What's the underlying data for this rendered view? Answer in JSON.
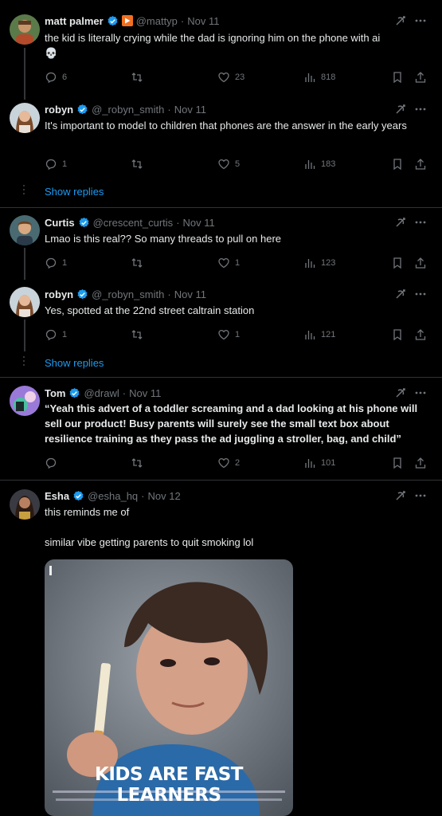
{
  "tweets": [
    {
      "name": "matt palmer",
      "handle": "@mattyp",
      "time": "Nov 11",
      "text": "the kid is literally crying while the dad is ignoring him on the phone with ai",
      "emoji": "💀",
      "replies": "6",
      "retweets": "",
      "likes": "23",
      "views": "818"
    },
    {
      "name": "robyn",
      "handle": "@_robyn_smith",
      "time": "Nov 11",
      "text": "It's important to model to children that phones are the answer in the early years",
      "replies": "1",
      "retweets": "",
      "likes": "5",
      "views": "183"
    },
    {
      "name": "Curtis",
      "handle": "@crescent_curtis",
      "time": "Nov 11",
      "text": "Lmao is this real?? So many threads to pull on here",
      "replies": "1",
      "retweets": "",
      "likes": "1",
      "views": "123"
    },
    {
      "name": "robyn",
      "handle": "@_robyn_smith",
      "time": "Nov 11",
      "text": "Yes, spotted at the 22nd street caltrain station",
      "replies": "1",
      "retweets": "",
      "likes": "1",
      "views": "121"
    },
    {
      "name": "Tom",
      "handle": "@drawl",
      "time": "Nov 11",
      "text": "“Yeah this advert of a toddler screaming and a dad looking at his phone will sell our product! Busy parents will surely see the small text box about resilience training as they pass the ad juggling a stroller, bag, and child”",
      "replies": "",
      "retweets": "",
      "likes": "2",
      "views": "101"
    },
    {
      "name": "Esha",
      "handle": "@esha_hq",
      "time": "Nov 12",
      "text": "this reminds me of",
      "text2": "similar vibe getting parents to quit smoking lol",
      "media_title": "KIDS ARE FAST LEARNERS"
    }
  ],
  "show_replies_label": "Show replies",
  "separator": "·",
  "colors": {
    "background": "#000000",
    "text": "#e7e9ea",
    "muted": "#71767b",
    "link": "#1d9bf0",
    "verified": "#1d9bf0",
    "border": "#2f3336"
  },
  "icons": {
    "reply": "reply-icon",
    "retweet": "retweet-icon",
    "like": "heart-icon",
    "views": "views-icon",
    "bookmark": "bookmark-icon",
    "share": "share-icon",
    "grok": "grok-icon",
    "more": "more-icon"
  }
}
